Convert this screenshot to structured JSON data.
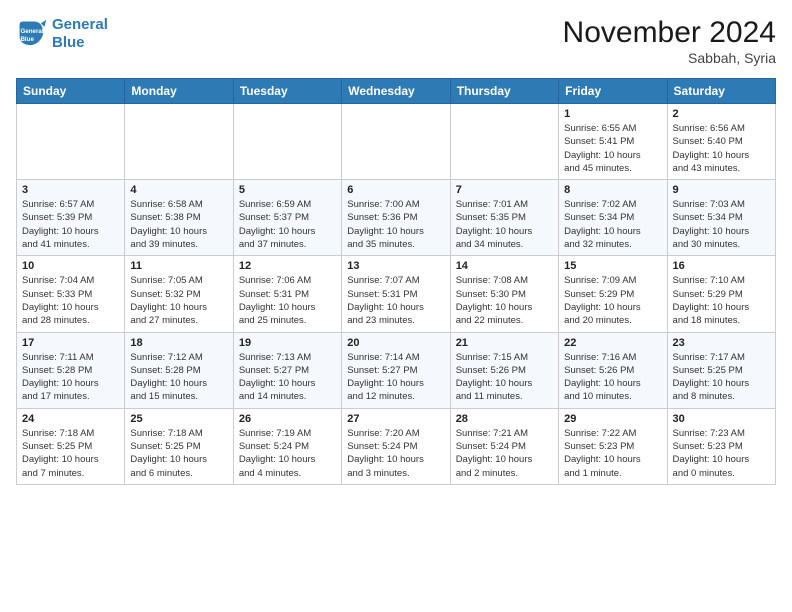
{
  "header": {
    "logo_line1": "General",
    "logo_line2": "Blue",
    "month": "November 2024",
    "location": "Sabbah, Syria"
  },
  "weekdays": [
    "Sunday",
    "Monday",
    "Tuesday",
    "Wednesday",
    "Thursday",
    "Friday",
    "Saturday"
  ],
  "weeks": [
    [
      {
        "day": "",
        "info": ""
      },
      {
        "day": "",
        "info": ""
      },
      {
        "day": "",
        "info": ""
      },
      {
        "day": "",
        "info": ""
      },
      {
        "day": "",
        "info": ""
      },
      {
        "day": "1",
        "info": "Sunrise: 6:55 AM\nSunset: 5:41 PM\nDaylight: 10 hours\nand 45 minutes."
      },
      {
        "day": "2",
        "info": "Sunrise: 6:56 AM\nSunset: 5:40 PM\nDaylight: 10 hours\nand 43 minutes."
      }
    ],
    [
      {
        "day": "3",
        "info": "Sunrise: 6:57 AM\nSunset: 5:39 PM\nDaylight: 10 hours\nand 41 minutes."
      },
      {
        "day": "4",
        "info": "Sunrise: 6:58 AM\nSunset: 5:38 PM\nDaylight: 10 hours\nand 39 minutes."
      },
      {
        "day": "5",
        "info": "Sunrise: 6:59 AM\nSunset: 5:37 PM\nDaylight: 10 hours\nand 37 minutes."
      },
      {
        "day": "6",
        "info": "Sunrise: 7:00 AM\nSunset: 5:36 PM\nDaylight: 10 hours\nand 35 minutes."
      },
      {
        "day": "7",
        "info": "Sunrise: 7:01 AM\nSunset: 5:35 PM\nDaylight: 10 hours\nand 34 minutes."
      },
      {
        "day": "8",
        "info": "Sunrise: 7:02 AM\nSunset: 5:34 PM\nDaylight: 10 hours\nand 32 minutes."
      },
      {
        "day": "9",
        "info": "Sunrise: 7:03 AM\nSunset: 5:34 PM\nDaylight: 10 hours\nand 30 minutes."
      }
    ],
    [
      {
        "day": "10",
        "info": "Sunrise: 7:04 AM\nSunset: 5:33 PM\nDaylight: 10 hours\nand 28 minutes."
      },
      {
        "day": "11",
        "info": "Sunrise: 7:05 AM\nSunset: 5:32 PM\nDaylight: 10 hours\nand 27 minutes."
      },
      {
        "day": "12",
        "info": "Sunrise: 7:06 AM\nSunset: 5:31 PM\nDaylight: 10 hours\nand 25 minutes."
      },
      {
        "day": "13",
        "info": "Sunrise: 7:07 AM\nSunset: 5:31 PM\nDaylight: 10 hours\nand 23 minutes."
      },
      {
        "day": "14",
        "info": "Sunrise: 7:08 AM\nSunset: 5:30 PM\nDaylight: 10 hours\nand 22 minutes."
      },
      {
        "day": "15",
        "info": "Sunrise: 7:09 AM\nSunset: 5:29 PM\nDaylight: 10 hours\nand 20 minutes."
      },
      {
        "day": "16",
        "info": "Sunrise: 7:10 AM\nSunset: 5:29 PM\nDaylight: 10 hours\nand 18 minutes."
      }
    ],
    [
      {
        "day": "17",
        "info": "Sunrise: 7:11 AM\nSunset: 5:28 PM\nDaylight: 10 hours\nand 17 minutes."
      },
      {
        "day": "18",
        "info": "Sunrise: 7:12 AM\nSunset: 5:28 PM\nDaylight: 10 hours\nand 15 minutes."
      },
      {
        "day": "19",
        "info": "Sunrise: 7:13 AM\nSunset: 5:27 PM\nDaylight: 10 hours\nand 14 minutes."
      },
      {
        "day": "20",
        "info": "Sunrise: 7:14 AM\nSunset: 5:27 PM\nDaylight: 10 hours\nand 12 minutes."
      },
      {
        "day": "21",
        "info": "Sunrise: 7:15 AM\nSunset: 5:26 PM\nDaylight: 10 hours\nand 11 minutes."
      },
      {
        "day": "22",
        "info": "Sunrise: 7:16 AM\nSunset: 5:26 PM\nDaylight: 10 hours\nand 10 minutes."
      },
      {
        "day": "23",
        "info": "Sunrise: 7:17 AM\nSunset: 5:25 PM\nDaylight: 10 hours\nand 8 minutes."
      }
    ],
    [
      {
        "day": "24",
        "info": "Sunrise: 7:18 AM\nSunset: 5:25 PM\nDaylight: 10 hours\nand 7 minutes."
      },
      {
        "day": "25",
        "info": "Sunrise: 7:18 AM\nSunset: 5:25 PM\nDaylight: 10 hours\nand 6 minutes."
      },
      {
        "day": "26",
        "info": "Sunrise: 7:19 AM\nSunset: 5:24 PM\nDaylight: 10 hours\nand 4 minutes."
      },
      {
        "day": "27",
        "info": "Sunrise: 7:20 AM\nSunset: 5:24 PM\nDaylight: 10 hours\nand 3 minutes."
      },
      {
        "day": "28",
        "info": "Sunrise: 7:21 AM\nSunset: 5:24 PM\nDaylight: 10 hours\nand 2 minutes."
      },
      {
        "day": "29",
        "info": "Sunrise: 7:22 AM\nSunset: 5:23 PM\nDaylight: 10 hours\nand 1 minute."
      },
      {
        "day": "30",
        "info": "Sunrise: 7:23 AM\nSunset: 5:23 PM\nDaylight: 10 hours\nand 0 minutes."
      }
    ]
  ]
}
